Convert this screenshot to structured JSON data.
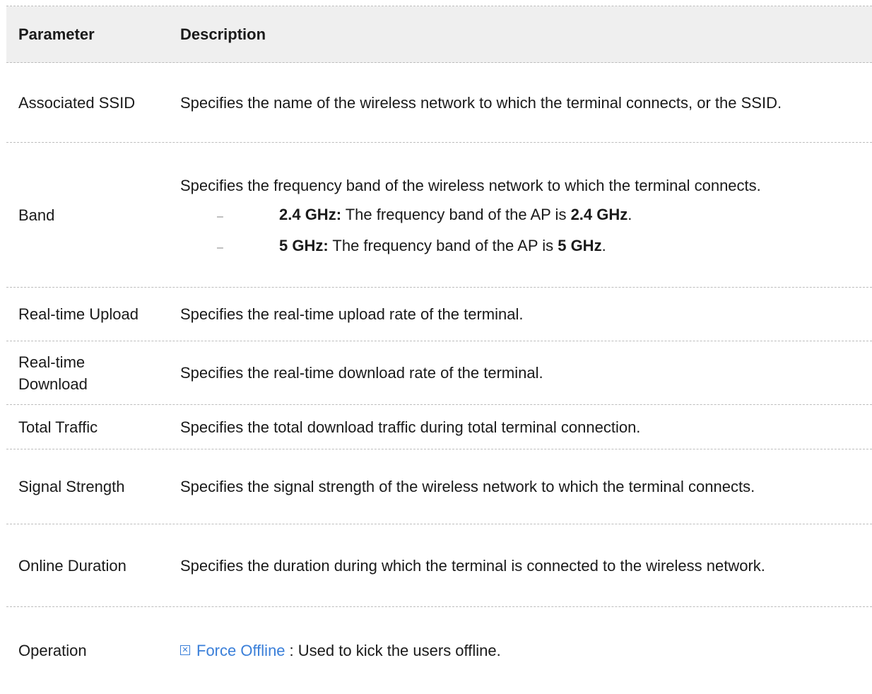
{
  "table": {
    "header": {
      "parameter": "Parameter",
      "description": "Description"
    },
    "rows": {
      "ssid": {
        "param": "Associated SSID",
        "desc": "Specifies the name of the wireless network to which the terminal connects, or the SSID."
      },
      "band": {
        "param": "Band",
        "desc": "Specifies the frequency band of the wireless network to which the terminal connects.",
        "bullets": [
          {
            "label": "2.4 GHz:",
            "text": " The frequency band of the AP is ",
            "value": "2.4 GHz",
            "end": "."
          },
          {
            "label": "5 GHz:",
            "text": " The frequency band of the AP is ",
            "value": "5 GHz",
            "end": "."
          }
        ]
      },
      "upload": {
        "param": "Real-time Upload",
        "desc": "Specifies the real-time upload rate of the terminal."
      },
      "download": {
        "param": "Real-time Download",
        "desc": "Specifies the real-time download rate of the terminal."
      },
      "total": {
        "param": "Total Traffic",
        "desc": "Specifies the total download traffic during total terminal connection."
      },
      "signal": {
        "param": "Signal Strength",
        "desc": "Specifies the signal strength of the wireless network to which the terminal connects."
      },
      "online": {
        "param": "Online Duration",
        "desc": "Specifies the duration during which the terminal is connected to the wireless network."
      },
      "operation": {
        "param": "Operation",
        "button_label": "Force Offline",
        "desc": ": Used to kick the users offline."
      }
    }
  },
  "colors": {
    "link": "#3a7fd9",
    "header_bg": "#efefef",
    "divider": "#bdbdbd"
  },
  "icons": {
    "force_offline": "close-box-icon"
  }
}
